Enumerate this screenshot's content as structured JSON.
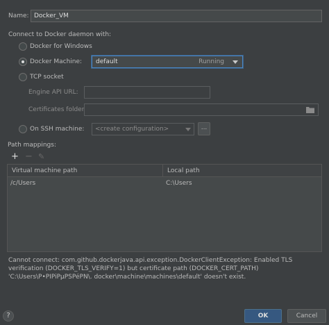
{
  "name": {
    "label": "Name:",
    "value": "Docker_VM"
  },
  "connect_section": "Connect to Docker daemon with:",
  "options": {
    "docker_for_windows": "Docker for Windows",
    "docker_machine": "Docker Machine:",
    "tcp_socket": "TCP socket",
    "ssh_machine": "On SSH machine:"
  },
  "docker_machine_combo": {
    "value": "default",
    "status": "Running",
    "icon": "chevron-down-icon"
  },
  "tcp": {
    "engine_api_label": "Engine API URL:",
    "engine_api_value": "",
    "cert_label": "Certificates folder:",
    "cert_value": "",
    "folder_icon": "folder-icon"
  },
  "ssh": {
    "placeholder": "<create configuration>",
    "browse_label": "..."
  },
  "path_mappings": {
    "label": "Path mappings:",
    "toolbar": {
      "add": "+",
      "remove": "−",
      "edit": "✎"
    },
    "columns": [
      "Virtual machine path",
      "Local path"
    ],
    "rows": [
      {
        "vm": "/c/Users",
        "local": "C:\\Users"
      }
    ]
  },
  "error_message": "Cannot connect: com.github.dockerjava.api.exception.DockerClientException: Enabled TLS verification (DOCKER_TLS_VERIFY=1) but certificate path (DOCKER_CERT_PATH) 'C:\\Users\\P•PIPiPµPSPéPN\\. docker\\machine\\machines\\default' doesn't exist.",
  "buttons": {
    "help": "?",
    "ok": "OK",
    "cancel": "Cancel"
  },
  "colors": {
    "background": "#3c3f41",
    "accent": "#4a88c7",
    "primary_button": "#365880"
  }
}
